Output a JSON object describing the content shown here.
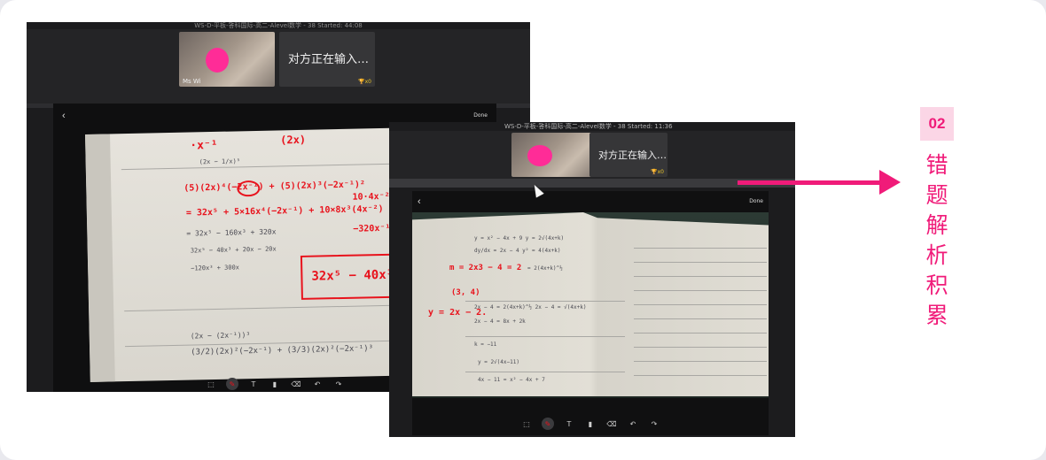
{
  "screen1": {
    "title": "WS-D-平板-答科国际-高二-Alevel数学 - 38   Started: 44:08",
    "cam_name": "Ms Wi",
    "voice_text": "对方正在输入…",
    "trophy": "x0",
    "done": "Done"
  },
  "screen2": {
    "title": "WS-D-平板-答科国际-高二-Alevel数学 - 38   Started: 11:36",
    "voice_text": "对方正在输入…",
    "trophy": "x0",
    "done": "Done"
  },
  "annotation": {
    "number": "02",
    "chars": [
      "错",
      "题",
      "解",
      "析",
      "积",
      "累"
    ]
  },
  "colors": {
    "accent": "#f01b79",
    "ink": "#e8121c"
  },
  "icons": [
    "back-icon",
    "pen-icon",
    "text-icon",
    "eraser-icon",
    "clear-icon",
    "undo-icon",
    "redo-icon",
    "cursor-icon",
    "trophy-icon"
  ]
}
